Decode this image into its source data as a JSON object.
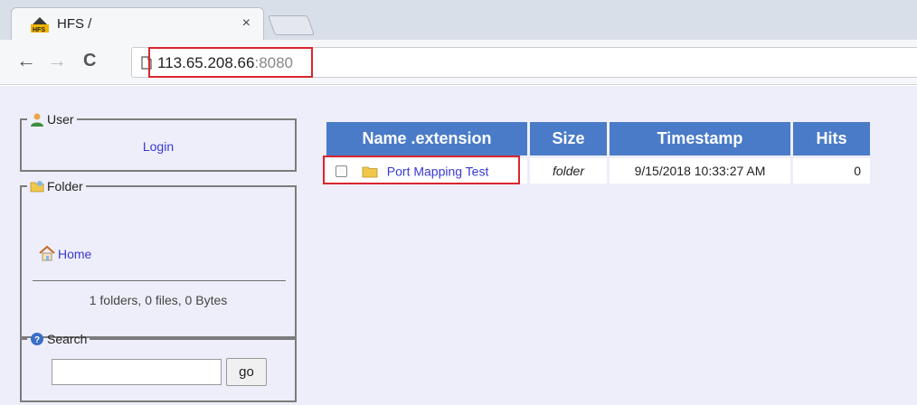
{
  "browser": {
    "tab_title": "HFS /",
    "tab_close": "×",
    "url_host": "113.65.208.66",
    "url_port": ":8080",
    "back_glyph": "←",
    "forward_glyph": "→",
    "reload_glyph": "C"
  },
  "sidebar": {
    "user": {
      "legend": "User",
      "login_label": "Login"
    },
    "folder": {
      "legend": "Folder",
      "home_label": "Home",
      "stats": "1 folders, 0 files, 0 Bytes"
    },
    "search": {
      "legend": "Search",
      "input_value": "",
      "go_label": "go"
    }
  },
  "file_table": {
    "headers": [
      "Name .extension",
      "Size",
      "Timestamp",
      "Hits"
    ],
    "rows": [
      {
        "name": "Port Mapping Test",
        "size": "folder",
        "timestamp": "9/15/2018 10:33:27 AM",
        "hits": "0"
      }
    ]
  },
  "colors": {
    "header_blue": "#4a7bc8",
    "link_blue": "#3838d4",
    "highlight_red": "#d9272e",
    "page_bg": "#eeeefa"
  },
  "icons": {
    "favicon": "hfs-logo-icon",
    "user": "user-icon",
    "folder": "folder-icon",
    "home": "home-icon",
    "search": "help-icon"
  }
}
